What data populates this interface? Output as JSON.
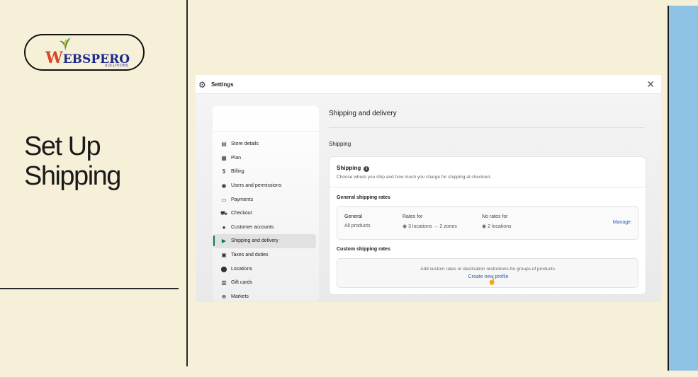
{
  "brand": {
    "logo_text_initial": "W",
    "logo_text_rest": "EBSPERO",
    "logo_subtext": "SOLUTIONS"
  },
  "slide": {
    "title_line1": "Set Up",
    "title_line2": "Shipping"
  },
  "window": {
    "title": "Settings",
    "close_icon": "close-icon"
  },
  "sidebar": {
    "items": [
      {
        "label": "Store details",
        "icon": "store-icon"
      },
      {
        "label": "Plan",
        "icon": "plan-icon"
      },
      {
        "label": "Billing",
        "icon": "billing-icon"
      },
      {
        "label": "Users and permissions",
        "icon": "user-icon"
      },
      {
        "label": "Payments",
        "icon": "payments-icon"
      },
      {
        "label": "Checkout",
        "icon": "cart-icon"
      },
      {
        "label": "Customer accounts",
        "icon": "person-icon"
      },
      {
        "label": "Shipping and delivery",
        "icon": "truck-icon",
        "active": true
      },
      {
        "label": "Taxes and duties",
        "icon": "tax-icon"
      },
      {
        "label": "Locations",
        "icon": "location-icon"
      },
      {
        "label": "Gift cards",
        "icon": "gift-icon"
      },
      {
        "label": "Markets",
        "icon": "globe-icon"
      }
    ]
  },
  "main": {
    "title": "Shipping and delivery",
    "section": "Shipping",
    "card": {
      "title": "Shipping",
      "description": "Choose where you ship and how much you charge for shipping at checkout.",
      "general_label": "General shipping rates",
      "rate": {
        "col1_title": "General",
        "col1_sub": "All products",
        "col2_title": "Rates for",
        "col2_sub": "3 locations → 2 zones",
        "col3_title": "No rates for",
        "col3_sub": "2 locations",
        "manage_label": "Manage"
      },
      "custom_label": "Custom shipping rates",
      "custom_desc": "Add custom rates or destination restrictions for groups of products.",
      "custom_link": "Create new profile"
    }
  },
  "colors": {
    "background": "#f7f0d9",
    "accent_blue": "#8ec3e6",
    "active_green": "#0a7a52",
    "link_blue": "#2c5fb5"
  }
}
